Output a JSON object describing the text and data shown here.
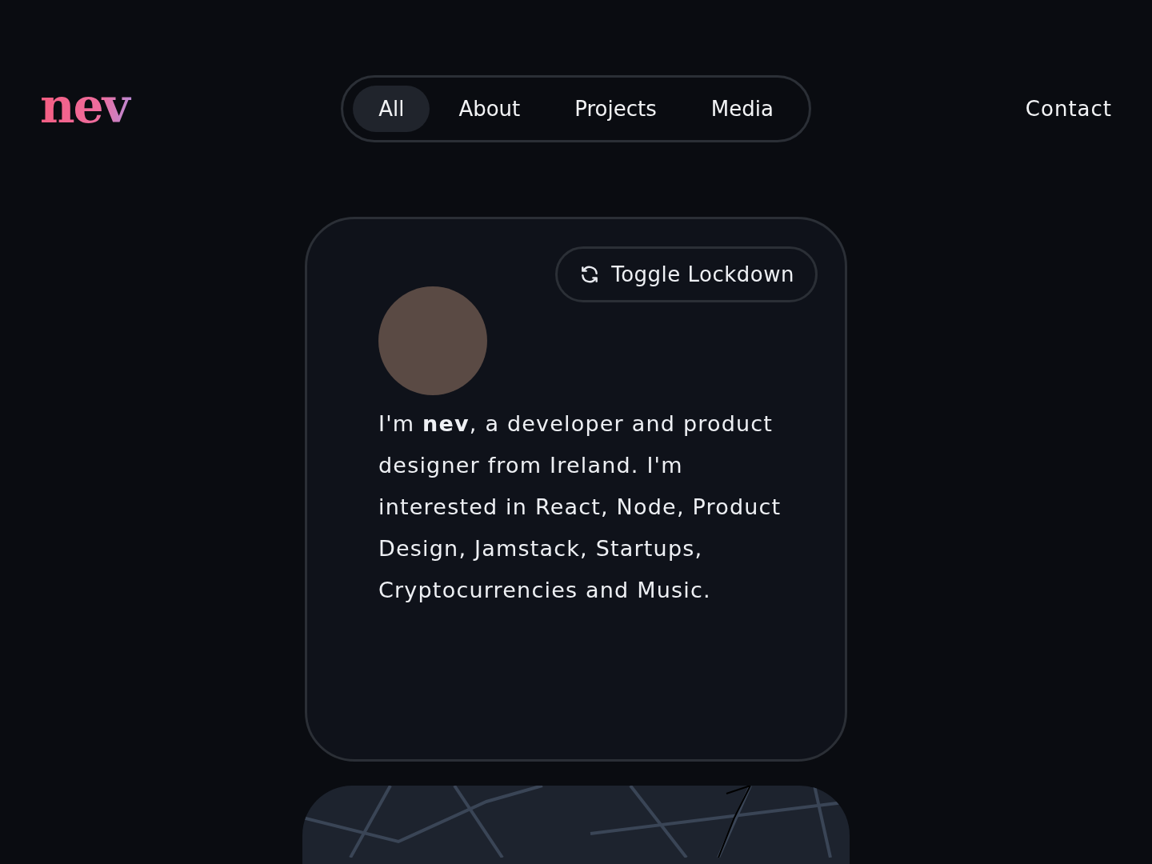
{
  "header": {
    "logo": "nev",
    "tabs": [
      {
        "label": "All",
        "selected": true
      },
      {
        "label": "About",
        "selected": false
      },
      {
        "label": "Projects",
        "selected": false
      },
      {
        "label": "Media",
        "selected": false
      }
    ],
    "contact": "Contact"
  },
  "intro_card": {
    "button": "Toggle Lockdown",
    "bio": "I'm **nev**, a developer and product designer from Ireland. I'm interested in React, Node, Product Design, Jamstack, Startups, Cryptocurrencies and Music."
  }
}
